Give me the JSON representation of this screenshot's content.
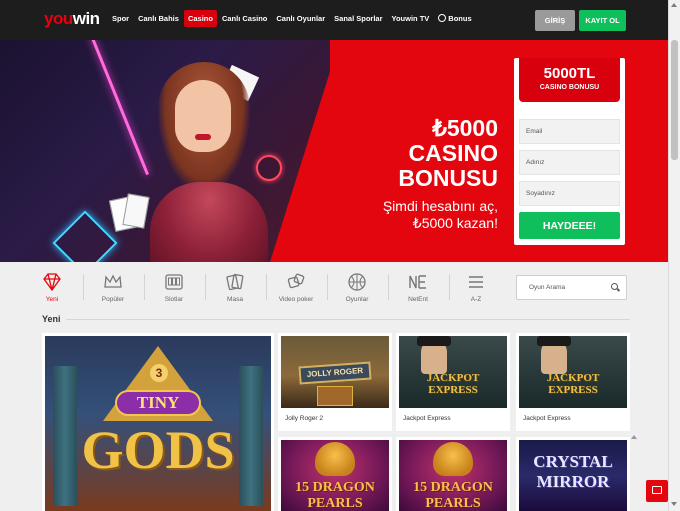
{
  "header": {
    "logo_you": "you",
    "logo_win": "win",
    "nav": [
      {
        "label": "Spor",
        "active": false
      },
      {
        "label": "Canlı Bahis",
        "active": false
      },
      {
        "label": "Casino",
        "active": true
      },
      {
        "label": "Canlı Casino",
        "active": false
      },
      {
        "label": "Canlı Oyunlar",
        "active": false
      },
      {
        "label": "Sanal Sporlar",
        "active": false
      },
      {
        "label": "Youwin TV",
        "active": false
      },
      {
        "label": "Bonus",
        "active": false
      }
    ],
    "login_label": "GİRİŞ",
    "register_label": "KAYIT OL"
  },
  "hero": {
    "amount_line": "₺5000",
    "line2": "CASINO",
    "line3": "BONUSU",
    "sub1": "Şimdi hesabını aç,",
    "sub2": "₺5000 kazan!",
    "slides_total": 5,
    "active_slide": 2
  },
  "signup": {
    "amount": "5000TL",
    "label": "CASINO BONUSU",
    "email_placeholder": "Email",
    "name_placeholder": "Adınız",
    "surname_placeholder": "Soyadınız",
    "submit_label": "HAYDEEE!"
  },
  "categories": [
    {
      "label": "Yeni",
      "icon": "diamond-icon",
      "active": true
    },
    {
      "label": "Popüler",
      "icon": "crown-icon",
      "active": false
    },
    {
      "label": "Slotlar",
      "icon": "slot-machine-icon",
      "active": false
    },
    {
      "label": "Masa",
      "icon": "cards-icon",
      "active": false
    },
    {
      "label": "Video poker",
      "icon": "dice-icon",
      "active": false
    },
    {
      "label": "Oyunlar",
      "icon": "ball-icon",
      "active": false
    },
    {
      "label": "NetEnt",
      "icon": "netent-icon",
      "active": false
    },
    {
      "label": "A-Z",
      "icon": "menu-icon",
      "active": false
    }
  ],
  "search": {
    "placeholder": "Oyun Arama"
  },
  "section": {
    "title": "Yeni"
  },
  "games": [
    {
      "name": "",
      "art": "Tiny Gods"
    },
    {
      "name": "Jolly Roger 2",
      "art": "Jolly Roger"
    },
    {
      "name": "Jackpot Express",
      "art": "Jackpot Express"
    },
    {
      "name": "Jackpot Express",
      "art": "Jackpot Express"
    },
    {
      "name": "",
      "art": "15 Dragon Pearls"
    },
    {
      "name": "",
      "art": "15 Dragon Pearls"
    },
    {
      "name": "",
      "art": "Crystal Mirror"
    }
  ],
  "art": {
    "tiny_num": "3",
    "tiny_word": "TINY",
    "gods_word": "GODS",
    "jolly_sign": "JOLLY ROGER",
    "jackpot_l1": "JACKPOT",
    "jackpot_l2": "EXPRESS",
    "dragon_l1": "15 DRAGON",
    "dragon_l2": "PEARLS",
    "crystal_l1": "CRYSTAL",
    "crystal_l2": "MIRROR"
  },
  "colors": {
    "brand_red": "#e3060f",
    "green": "#0fbf5c",
    "header_bg": "#1d1d1d"
  }
}
